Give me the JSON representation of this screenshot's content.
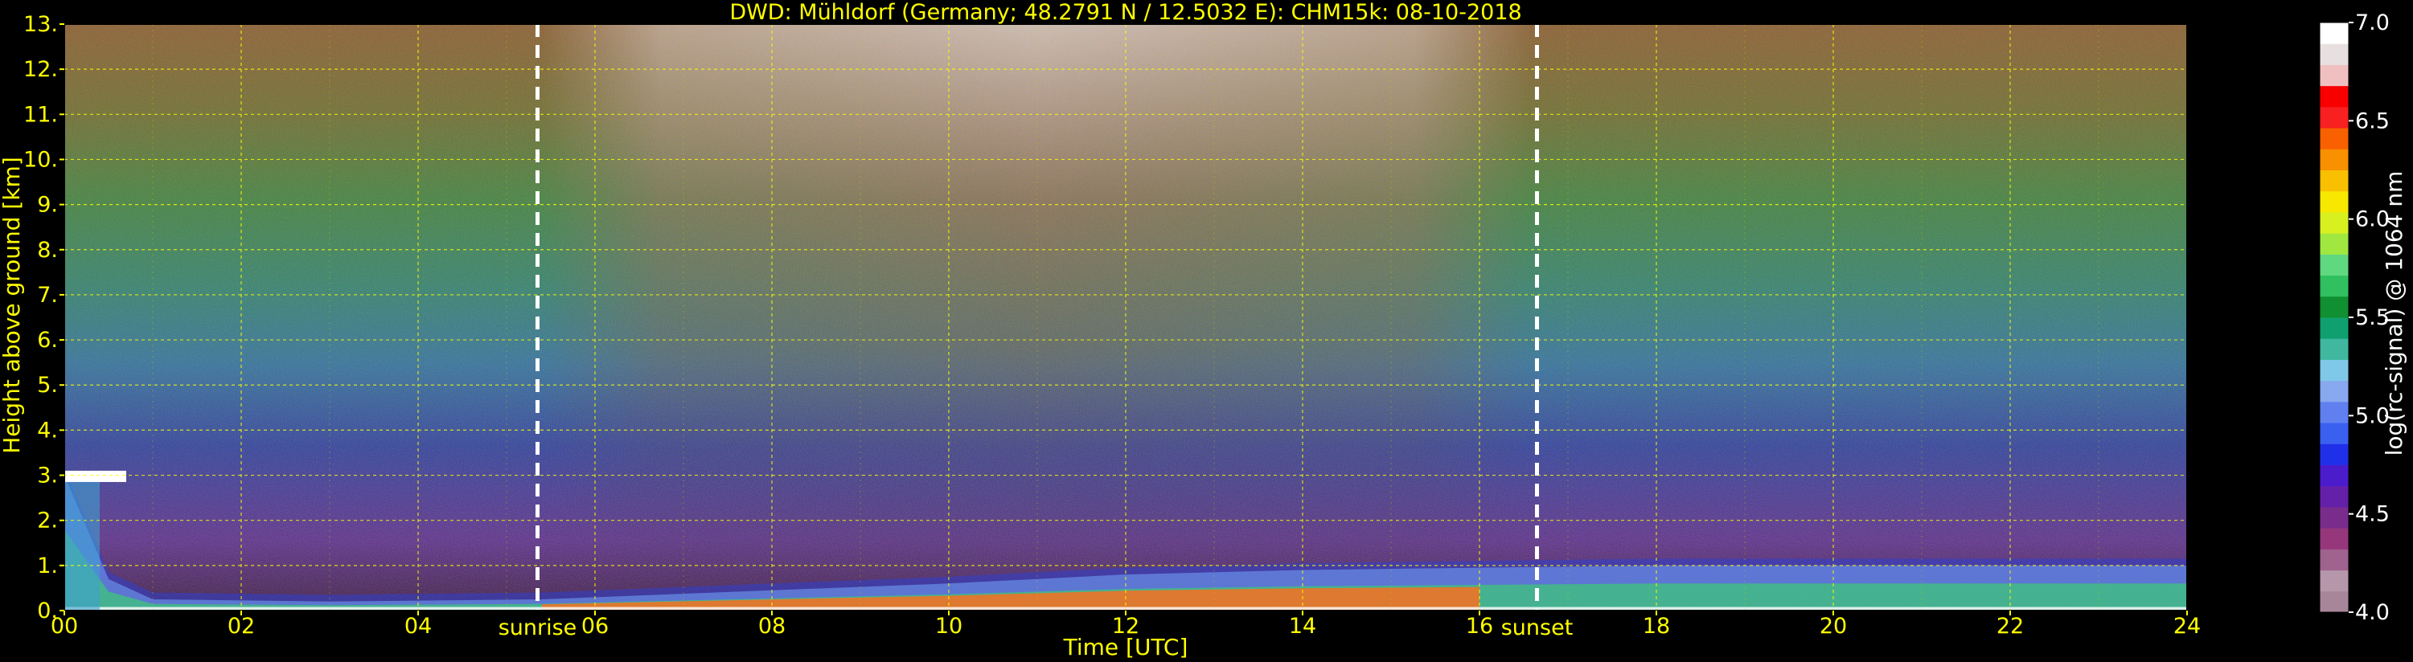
{
  "chart_data": {
    "type": "heatmap",
    "title": "DWD: Mühldorf (Germany; 48.2791 N / 12.5032 E):    CHM15k: 08-10-2018",
    "xlabel": "Time [UTC]",
    "ylabel": "Height above ground [km]",
    "xlim": [
      0,
      24
    ],
    "ylim": [
      0,
      13
    ],
    "x_ticks": [
      "00",
      "02",
      "04",
      "06",
      "08",
      "10",
      "12",
      "14",
      "16",
      "18",
      "20",
      "22",
      "24"
    ],
    "y_ticks": [
      "0.",
      "1.",
      "2.",
      "3.",
      "4.",
      "5.",
      "6.",
      "7.",
      "8.",
      "9.",
      "10.",
      "11.",
      "12.",
      "13."
    ],
    "grid": true,
    "annotations": [
      {
        "label": "sunrise",
        "x": 5.35
      },
      {
        "label": "sunset",
        "x": 16.65
      }
    ],
    "colorbar": {
      "label": "log(rc-signal) @ 1064 nm",
      "range": [
        4.0,
        7.0
      ],
      "ticks": [
        "4.0",
        "4.5",
        "5.0",
        "5.5",
        "6.0",
        "6.5",
        "7.0"
      ],
      "colors": [
        "#a8869a",
        "#b596aa",
        "#a0628e",
        "#96377c",
        "#7a2c8c",
        "#6420a8",
        "#4a1ccc",
        "#2030e8",
        "#3a60f0",
        "#6080f0",
        "#88a8f0",
        "#80c8e8",
        "#40b8a0",
        "#10a070",
        "#109030",
        "#30c060",
        "#60d880",
        "#a0e840",
        "#d8f020",
        "#f8e800",
        "#f8c000",
        "#f89000",
        "#f86000",
        "#f82020",
        "#f80000",
        "#f0c0c0",
        "#e8e0e0",
        "#ffffff"
      ]
    },
    "boundary_layer": [
      {
        "x": 0,
        "top_km": 3.0,
        "cloud_km": 3.0
      },
      {
        "x": 0.5,
        "top_km": 0.7
      },
      {
        "x": 1,
        "top_km": 0.25
      },
      {
        "x": 3,
        "top_km": 0.2
      },
      {
        "x": 5.4,
        "top_km": 0.25
      },
      {
        "x": 8,
        "top_km": 0.45
      },
      {
        "x": 10,
        "top_km": 0.6
      },
      {
        "x": 12,
        "top_km": 0.8
      },
      {
        "x": 14,
        "top_km": 0.9
      },
      {
        "x": 16,
        "top_km": 0.95
      },
      {
        "x": 18,
        "top_km": 1.0
      },
      {
        "x": 20,
        "top_km": 1.0
      },
      {
        "x": 22,
        "top_km": 1.0
      },
      {
        "x": 24,
        "top_km": 1.0
      }
    ]
  }
}
